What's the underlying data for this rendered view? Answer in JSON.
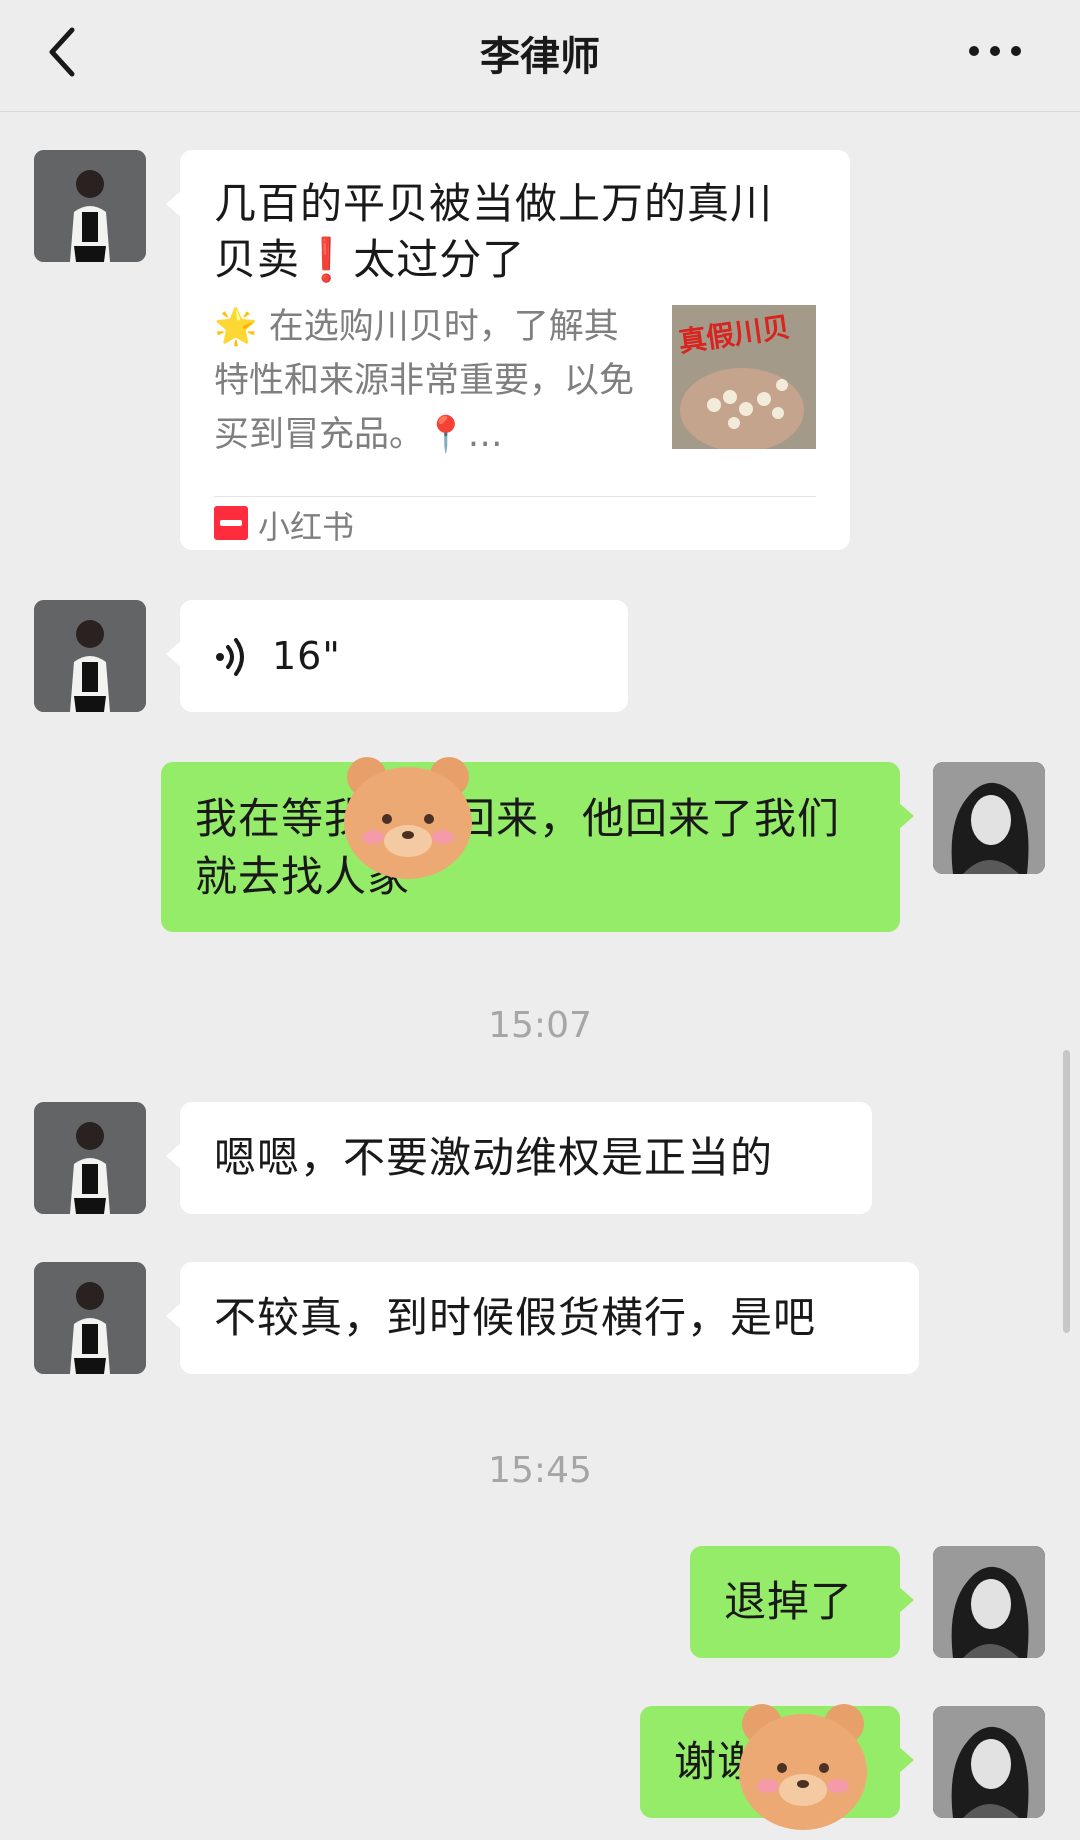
{
  "header": {
    "title": "李律师"
  },
  "messages": {
    "card": {
      "title": "几百的平贝被当做上万的真川贝卖❗️太过分了",
      "desc": "🌟 在选购川贝时，了解其特性和来源非常重要，以免买到冒充品。📍…",
      "thumb_text": "真假川贝",
      "source": "小红书"
    },
    "voice": {
      "duration": "16\""
    },
    "m1": "我在等我老公回来，他回来了我们就去找人家",
    "time1": "15:07",
    "m2": "嗯嗯，不要激动维权是正当的",
    "m3": "不较真，到时候假货横行，是吧",
    "time2": "15:45",
    "m4": "退掉了",
    "m5": "谢谢你了"
  },
  "colors": {
    "background": "#ededed",
    "self_bubble": "#95ec69",
    "other_bubble": "#ffffff"
  }
}
